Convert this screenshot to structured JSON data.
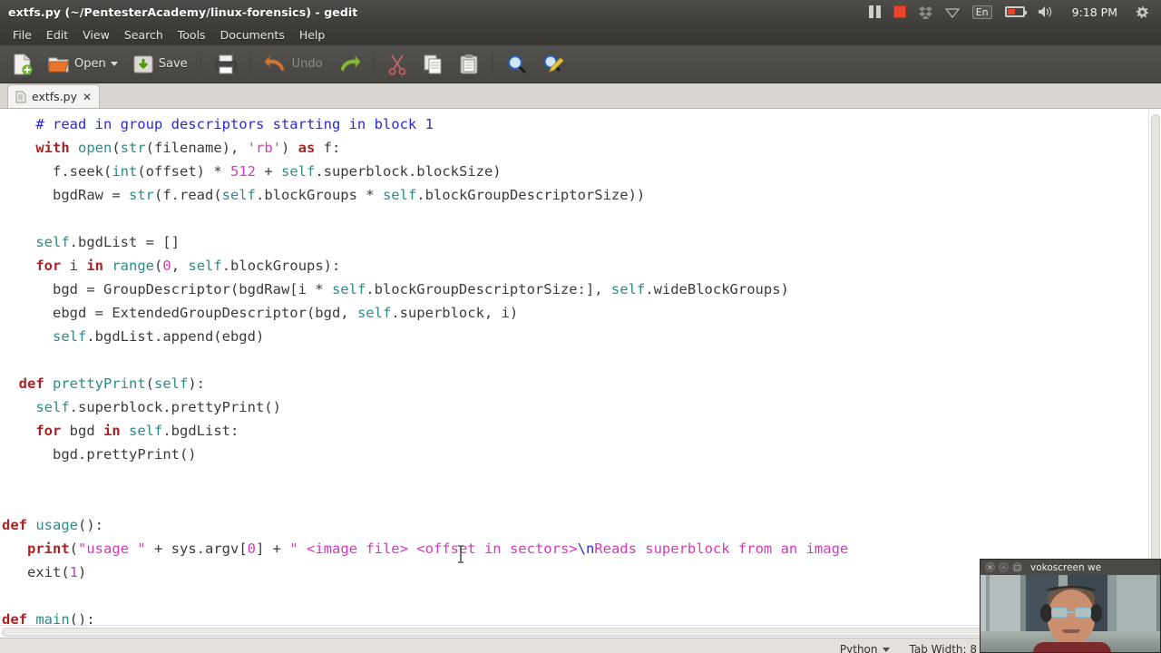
{
  "window": {
    "title": "extfs.py (~/PentesterAcademy/linux-forensics) - gedit"
  },
  "tray": {
    "pause_icon": "pause-icon",
    "record_stop_icon": "record-stop-icon",
    "dropbox_icon": "dropbox-icon",
    "wifi_icon": "wifi-icon",
    "keyboard_layout": "En",
    "battery_icon": "battery-icon",
    "volume_icon": "volume-icon",
    "clock": "9:18 PM",
    "session_icon": "session-gear-icon"
  },
  "menubar": {
    "items": [
      {
        "label": "File"
      },
      {
        "label": "Edit"
      },
      {
        "label": "View"
      },
      {
        "label": "Search"
      },
      {
        "label": "Tools"
      },
      {
        "label": "Documents"
      },
      {
        "label": "Help"
      }
    ]
  },
  "toolbar": {
    "new_label": "",
    "open_label": "Open",
    "save_label": "Save",
    "print_label": "",
    "undo_label": "Undo",
    "redo_label": "",
    "cut_label": "",
    "copy_label": "",
    "paste_label": "",
    "find_label": "",
    "replace_label": ""
  },
  "tabs": [
    {
      "title": "extfs.py",
      "close": "✕"
    }
  ],
  "editor": {
    "language": "python",
    "lines": [
      {
        "indent": 4,
        "tokens": [
          {
            "t": "cmt",
            "v": "# read in group descriptors starting in block 1"
          }
        ]
      },
      {
        "indent": 4,
        "tokens": [
          {
            "t": "kw",
            "v": "with"
          },
          {
            "t": "p",
            "v": " "
          },
          {
            "t": "bi",
            "v": "open"
          },
          {
            "t": "p",
            "v": "("
          },
          {
            "t": "bi",
            "v": "str"
          },
          {
            "t": "p",
            "v": "(filename), "
          },
          {
            "t": "str",
            "v": "'rb'"
          },
          {
            "t": "p",
            "v": ") "
          },
          {
            "t": "kw",
            "v": "as"
          },
          {
            "t": "p",
            "v": " f:"
          }
        ]
      },
      {
        "indent": 6,
        "tokens": [
          {
            "t": "p",
            "v": "f.seek("
          },
          {
            "t": "bi",
            "v": "int"
          },
          {
            "t": "p",
            "v": "(offset) * "
          },
          {
            "t": "num",
            "v": "512"
          },
          {
            "t": "p",
            "v": " + "
          },
          {
            "t": "self",
            "v": "self"
          },
          {
            "t": "p",
            "v": ".superblock.blockSize)"
          }
        ]
      },
      {
        "indent": 6,
        "tokens": [
          {
            "t": "p",
            "v": "bgdRaw = "
          },
          {
            "t": "bi",
            "v": "str"
          },
          {
            "t": "p",
            "v": "(f.read("
          },
          {
            "t": "self",
            "v": "self"
          },
          {
            "t": "p",
            "v": ".blockGroups * "
          },
          {
            "t": "self",
            "v": "self"
          },
          {
            "t": "p",
            "v": ".blockGroupDescriptorSize))"
          }
        ]
      },
      {
        "indent": 0,
        "tokens": []
      },
      {
        "indent": 4,
        "tokens": [
          {
            "t": "self",
            "v": "self"
          },
          {
            "t": "p",
            "v": ".bgdList = []"
          }
        ]
      },
      {
        "indent": 4,
        "tokens": [
          {
            "t": "kw",
            "v": "for"
          },
          {
            "t": "p",
            "v": " i "
          },
          {
            "t": "kw",
            "v": "in"
          },
          {
            "t": "p",
            "v": " "
          },
          {
            "t": "bi",
            "v": "range"
          },
          {
            "t": "p",
            "v": "("
          },
          {
            "t": "num",
            "v": "0"
          },
          {
            "t": "p",
            "v": ", "
          },
          {
            "t": "self",
            "v": "self"
          },
          {
            "t": "p",
            "v": ".blockGroups):"
          }
        ]
      },
      {
        "indent": 6,
        "tokens": [
          {
            "t": "p",
            "v": "bgd = GroupDescriptor(bgdRaw[i * "
          },
          {
            "t": "self",
            "v": "self"
          },
          {
            "t": "p",
            "v": ".blockGroupDescriptorSize:], "
          },
          {
            "t": "self",
            "v": "self"
          },
          {
            "t": "p",
            "v": ".wideBlockGroups)"
          }
        ]
      },
      {
        "indent": 6,
        "tokens": [
          {
            "t": "p",
            "v": "ebgd = ExtendedGroupDescriptor(bgd, "
          },
          {
            "t": "self",
            "v": "self"
          },
          {
            "t": "p",
            "v": ".superblock, i)"
          }
        ]
      },
      {
        "indent": 6,
        "tokens": [
          {
            "t": "self",
            "v": "self"
          },
          {
            "t": "p",
            "v": ".bgdList.append(ebgd)"
          }
        ]
      },
      {
        "indent": 0,
        "tokens": []
      },
      {
        "indent": 2,
        "tokens": [
          {
            "t": "kw",
            "v": "def"
          },
          {
            "t": "p",
            "v": " "
          },
          {
            "t": "fn",
            "v": "prettyPrint"
          },
          {
            "t": "p",
            "v": "("
          },
          {
            "t": "self",
            "v": "self"
          },
          {
            "t": "p",
            "v": "):"
          }
        ]
      },
      {
        "indent": 4,
        "tokens": [
          {
            "t": "self",
            "v": "self"
          },
          {
            "t": "p",
            "v": ".superblock.prettyPrint()"
          }
        ]
      },
      {
        "indent": 4,
        "tokens": [
          {
            "t": "kw",
            "v": "for"
          },
          {
            "t": "p",
            "v": " bgd "
          },
          {
            "t": "kw",
            "v": "in"
          },
          {
            "t": "p",
            "v": " "
          },
          {
            "t": "self",
            "v": "self"
          },
          {
            "t": "p",
            "v": ".bgdList:"
          }
        ]
      },
      {
        "indent": 6,
        "tokens": [
          {
            "t": "p",
            "v": "bgd.prettyPrint()"
          }
        ]
      },
      {
        "indent": 0,
        "tokens": []
      },
      {
        "indent": 0,
        "tokens": []
      },
      {
        "indent": 0,
        "tokens": [
          {
            "t": "kw",
            "v": "def"
          },
          {
            "t": "p",
            "v": " "
          },
          {
            "t": "fn",
            "v": "usage"
          },
          {
            "t": "p",
            "v": "():"
          }
        ]
      },
      {
        "indent": 3,
        "tokens": [
          {
            "t": "kw",
            "v": "print"
          },
          {
            "t": "p",
            "v": "("
          },
          {
            "t": "str",
            "v": "\"usage \""
          },
          {
            "t": "p",
            "v": " + sys.argv["
          },
          {
            "t": "num",
            "v": "0"
          },
          {
            "t": "p",
            "v": "] + "
          },
          {
            "t": "str",
            "v": "\" <image file> <offset in sectors>"
          },
          {
            "t": "esc",
            "v": "\\n"
          },
          {
            "t": "str",
            "v": "Reads superblock from an image"
          }
        ]
      },
      {
        "indent": 3,
        "tokens": [
          {
            "t": "p",
            "v": "exit("
          },
          {
            "t": "num",
            "v": "1"
          },
          {
            "t": "p",
            "v": ")"
          }
        ]
      },
      {
        "indent": 0,
        "tokens": []
      },
      {
        "indent": 0,
        "tokens": [
          {
            "t": "kw",
            "v": "def"
          },
          {
            "t": "p",
            "v": " "
          },
          {
            "t": "fn",
            "v": "main"
          },
          {
            "t": "p",
            "v": "():"
          }
        ]
      }
    ]
  },
  "statusbar": {
    "language": "Python",
    "tab_width": "Tab Width: 8"
  },
  "webcam": {
    "title": "vokoscreen we",
    "close_glyph": "×",
    "minimize_glyph": "–",
    "maximize_glyph": "□"
  },
  "colors": {
    "keyword": "#a62426",
    "builtin": "#2e8b86",
    "string": "#d33abb",
    "comment": "#2a2ad6",
    "titlebar": "#45433f",
    "accent_red": "#e8452c"
  }
}
